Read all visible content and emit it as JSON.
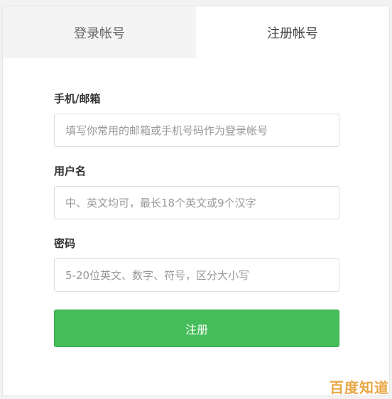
{
  "tabs": {
    "login": "登录帐号",
    "register": "注册帐号"
  },
  "form": {
    "account_label": "手机/邮箱",
    "account_placeholder": "填写你常用的邮箱或手机号码作为登录帐号",
    "username_label": "用户名",
    "username_placeholder": "中、英文均可，最长18个英文或9个汉字",
    "password_label": "密码",
    "password_placeholder": "5-20位英文、数字、符号，区分大小写",
    "submit_label": "注册"
  },
  "colors": {
    "submit_green": "#45bd5a",
    "watermark_orange": "#e8a33a"
  },
  "watermark": "百度知道"
}
